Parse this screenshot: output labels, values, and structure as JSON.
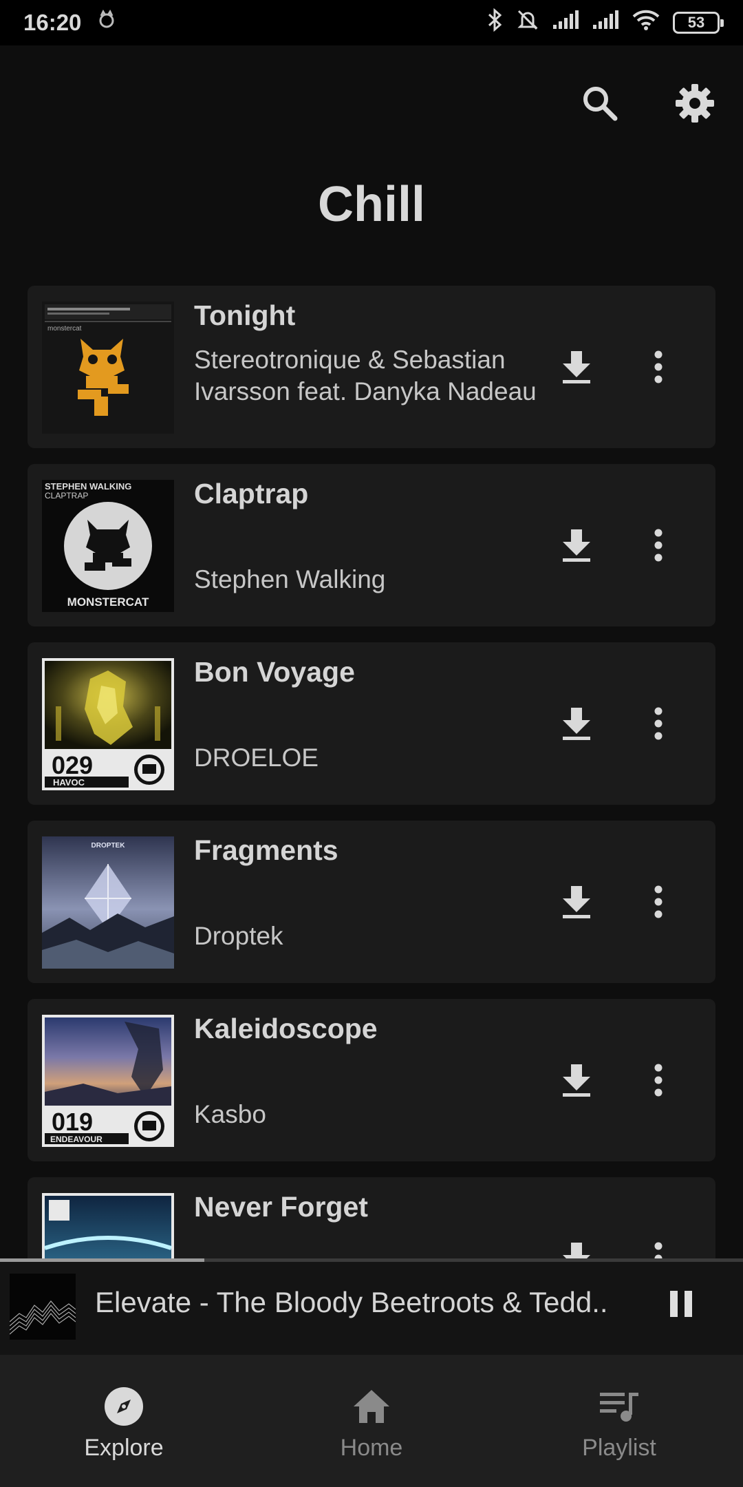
{
  "status_bar": {
    "time": "16:20",
    "battery": "53",
    "icons": [
      "dog-app-icon",
      "bluetooth-icon",
      "bell-off-icon",
      "signal-icon",
      "signal-icon",
      "wifi-icon",
      "battery-icon"
    ]
  },
  "header": {
    "title": "Chill",
    "icons": [
      "search-icon",
      "gear-icon"
    ]
  },
  "songs": [
    {
      "title": "Tonight",
      "artist": "Stereotronique & Sebastian Ivarsson feat. Danyka Nadeau",
      "cover_label": "monstercat"
    },
    {
      "title": "Claptrap",
      "artist": "Stephen Walking",
      "cover_label": "STEPHEN WALKING",
      "cover_sub": "CLAPTRAP",
      "cover_brand": "MONSTERCAT"
    },
    {
      "title": "Bon Voyage",
      "artist": "DROELOE",
      "cover_number": "029",
      "cover_sub": "HAVOC"
    },
    {
      "title": "Fragments",
      "artist": "Droptek",
      "cover_label": "DROPTEK"
    },
    {
      "title": "Kaleidoscope",
      "artist": "Kasbo",
      "cover_number": "019",
      "cover_sub": "ENDEAVOUR"
    },
    {
      "title": "Never Forget",
      "artist": ""
    }
  ],
  "now_playing": {
    "text": "Elevate  - The Bloody Beetroots & Tedd..",
    "progress": 0.275
  },
  "bottom_nav": [
    {
      "label": "Explore",
      "icon": "compass-icon",
      "active": true
    },
    {
      "label": "Home",
      "icon": "home-icon",
      "active": false
    },
    {
      "label": "Playlist",
      "icon": "playlist-icon",
      "active": false
    }
  ],
  "colors": {
    "background": "#0e0e0e",
    "card": "#1b1b1b",
    "text": "#d5d5d5",
    "nav_bg": "#1f1f1f"
  }
}
